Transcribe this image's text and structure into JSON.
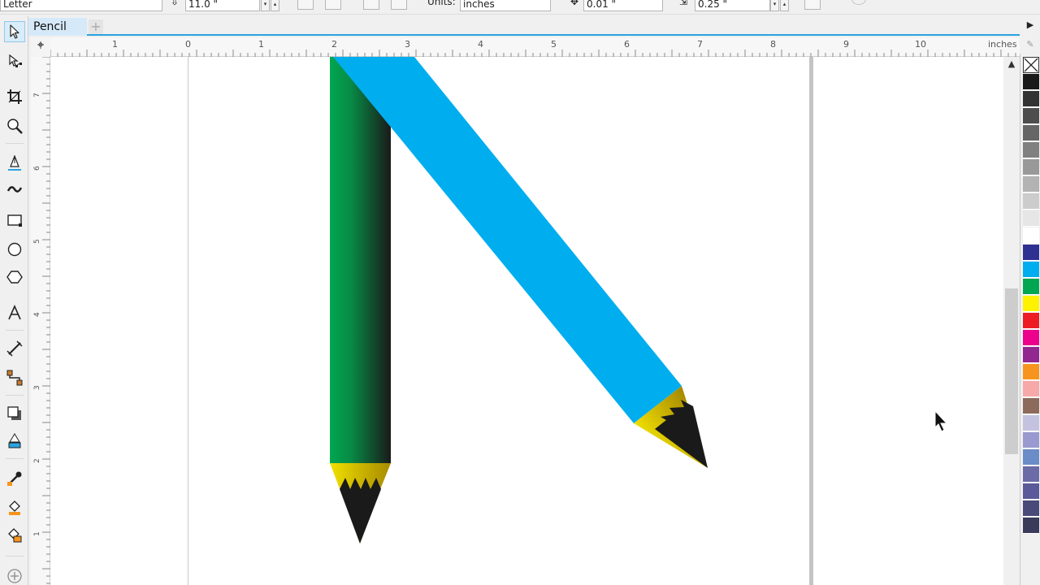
{
  "property_bar": {
    "preset_value": "Letter",
    "height_value": "11.0 \"",
    "units_label": "Units:",
    "units_value": "inches",
    "nudge_value": "0.01 \"",
    "duplicate_distance_value": "0.25 \""
  },
  "tabs": [
    {
      "label": "Pencil"
    }
  ],
  "ruler": {
    "unit": "inches",
    "h_ticks": [
      "1",
      "0",
      "1",
      "2",
      "3",
      "4",
      "5",
      "6",
      "7",
      "8",
      "9",
      "10"
    ],
    "v_ticks": [
      "7",
      "6",
      "5",
      "4",
      "3",
      "2",
      "1"
    ]
  },
  "toolbox": {
    "tools": [
      "pick-tool-icon",
      "shape-tool-icon",
      "crop-tool-icon",
      "zoom-tool-icon",
      "freehand-tool-icon",
      "artistic-media-tool-icon",
      "rectangle-tool-icon",
      "ellipse-tool-icon",
      "polygon-tool-icon",
      "text-tool-icon",
      "parallel-dimension-tool-icon",
      "connector-tool-icon",
      "drop-shadow-tool-icon",
      "transparency-tool-icon",
      "color-eyedropper-tool-icon",
      "interactive-fill-tool-icon",
      "smart-fill-tool-icon",
      "add-tool-icon"
    ]
  },
  "palette": {
    "colors": [
      "none",
      "#1a1a1a",
      "#333333",
      "#4d4d4d",
      "#666666",
      "#808080",
      "#999999",
      "#b3b3b3",
      "#cccccc",
      "#e6e6e6",
      "#ffffff",
      "#2e3192",
      "#00aeef",
      "#00a651",
      "#fff200",
      "#ed1c24",
      "#ec008c",
      "#92278f",
      "#f7941d",
      "#f7a8a8",
      "#8c6b5d",
      "#c3c3e0",
      "#9a9ad0",
      "#6a8cc7",
      "#6b6ba8",
      "#5a5a9a",
      "#4a4a7a",
      "#3a3a5a"
    ]
  },
  "drawing": {
    "objects": [
      {
        "name": "green-pencil",
        "body_gradient": [
          "#00a651",
          "#1a1a1a"
        ],
        "tip_color": "#e8d400",
        "lead_color": "#1a1a1a"
      },
      {
        "name": "blue-pencil",
        "body_gradient": [
          "#00aeef",
          "#1a1a1a"
        ],
        "tip_color": "#e8d400",
        "lead_color": "#1a1a1a"
      }
    ]
  }
}
